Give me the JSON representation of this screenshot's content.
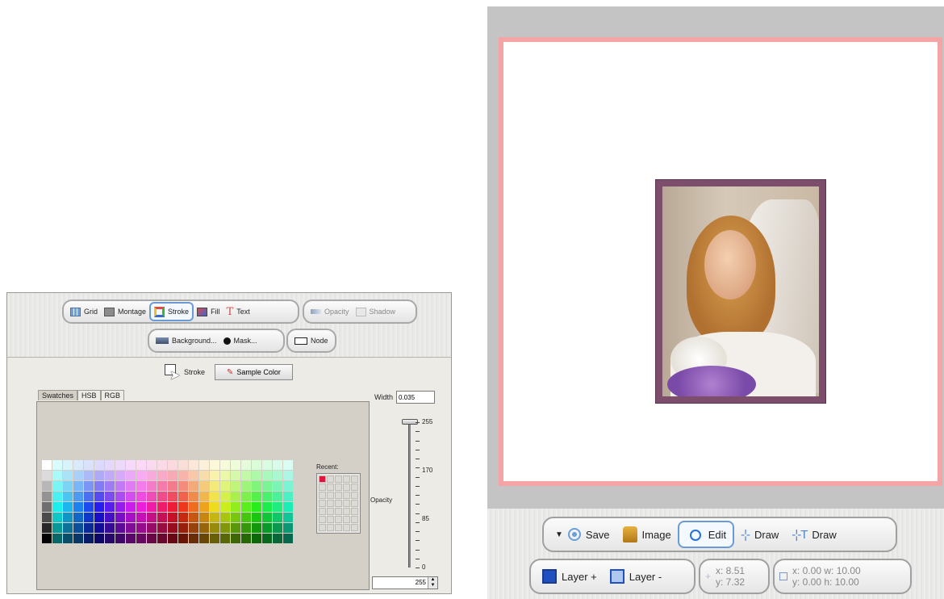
{
  "left_panel": {
    "toolbar_row1": {
      "grid": "Grid",
      "montage": "Montage",
      "stroke": "Stroke",
      "fill": "Fill",
      "text": "Text",
      "opacity": "Opacity",
      "shadow": "Shadow"
    },
    "toolbar_row2": {
      "background": "Background...",
      "mask": "Mask...",
      "node": "Node"
    },
    "stroke_label": "Stroke",
    "sample_color": "Sample Color",
    "tabs": [
      "Swatches",
      "HSB",
      "RGB"
    ],
    "recent_label": "Recent:",
    "recent_selected_color": "#e0143c",
    "width_label": "Width",
    "width_value": "0.035",
    "opacity_label": "Opacity",
    "opacity_ticks": [
      "255",
      "170",
      "85",
      "0"
    ],
    "opacity_value": "255",
    "opacity_level": 1.0
  },
  "right_panel": {
    "frame_color": "#f4a4a4",
    "mat_color": "#7d4e6c",
    "toolbar_row1": {
      "save": "Save",
      "image": "Image",
      "edit": "Edit",
      "draw": "Draw",
      "text_draw": "Draw"
    },
    "toolbar_row2": {
      "layer_add": "Layer +",
      "layer_remove": "Layer -",
      "cursor_x": "x: 8.51",
      "cursor_y": "y: 7.32",
      "bounds_xw": "x: 0.00 w: 10.00",
      "bounds_yh": "y: 0.00 h: 10.00"
    }
  }
}
